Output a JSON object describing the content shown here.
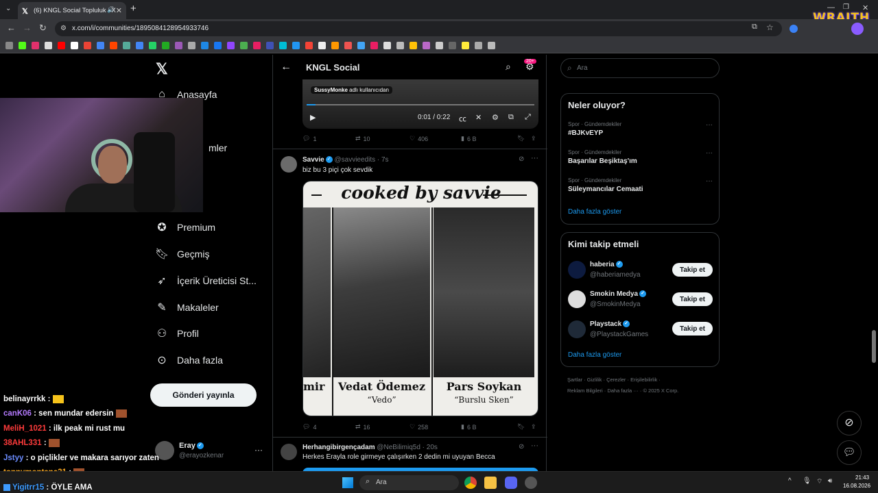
{
  "browser": {
    "tab_title": "(6) KNGL Social Topluluk / X",
    "url": "x.com/i/communities/1895084128954933746",
    "plus": "+"
  },
  "overlay": {
    "wraith_logo": "WRAITH"
  },
  "sidebar": {
    "items": [
      {
        "label": "Anasayfa",
        "icon": "home-icon"
      },
      {
        "label": "Premium",
        "icon": "premium-icon"
      },
      {
        "label": "Geçmiş",
        "icon": "bookmark-icon"
      },
      {
        "label": "İçerik Üreticisi St...",
        "icon": "rocket-icon"
      },
      {
        "label": "Makaleler",
        "icon": "article-icon"
      },
      {
        "label": "Profil",
        "icon": "profile-icon"
      },
      {
        "label": "Daha fazla",
        "icon": "more-circle-icon"
      }
    ],
    "post_button": "Gönderi yayınla",
    "partial_labels": [
      "mler",
      "t"
    ],
    "account": {
      "name": "Eray",
      "handle": "@erayozkenar",
      "more": "···"
    }
  },
  "header": {
    "title": "KNGL Social",
    "badge": "20+"
  },
  "video_post": {
    "overlay_user": "SussyMonke",
    "overlay_text": "adlı kullanıcıdan",
    "time": "0:01 / 0:22",
    "replies": "1",
    "reposts": "10",
    "likes": "406",
    "views": "6 B"
  },
  "post2": {
    "name": "Savvie",
    "handle": "@savvieedits · 7s",
    "text": "biz bu 3 piçi çok sevdik",
    "image_title": "cooked by savvie",
    "panels": [
      {
        "name": "mir",
        "nick": ""
      },
      {
        "name": "Vedat Ödemez",
        "nick": "“Vedo”"
      },
      {
        "name": "Pars Soykan",
        "nick": "“Burslu Sken”"
      }
    ],
    "replies": "4",
    "reposts": "16",
    "likes": "258",
    "views": "6 B"
  },
  "post3": {
    "name": "Herhangibirgençadam",
    "handle": "@NeBilimiq5d · 20s",
    "text": "Herkes Erayla role girmeye çalışırken 2 dedin mi uyuyan Becca"
  },
  "search": {
    "placeholder": "Ara"
  },
  "trends": {
    "title": "Neler oluyor?",
    "items": [
      {
        "category": "Spor · Gündemdekiler",
        "name": "#BJKvEYP"
      },
      {
        "category": "Spor · Gündemdekiler",
        "name": "Başarılar Beşiktaş'ım"
      },
      {
        "category": "Spor · Gündemdekiler",
        "name": "Süleymancılar Cemaati"
      }
    ],
    "show_more": "Daha fazla göster"
  },
  "who_to_follow": {
    "title": "Kimi takip etmeli",
    "items": [
      {
        "name": "haberia",
        "handle": "@haberiamedya",
        "button": "Takip et"
      },
      {
        "name": "Smokin Medya",
        "handle": "@SmokinMedya",
        "button": "Takip et"
      },
      {
        "name": "Playstack",
        "handle": "@PlaystackGames",
        "button": "Takip et"
      }
    ],
    "show_more": "Daha fazla göster"
  },
  "footer": {
    "line1": "Şartlar · Gizlilik · Çerezler · Erişilebilirlik ·",
    "line2": "Reklam Bilgileri · Daha fazla ··· · © 2025 X Corp."
  },
  "chat": [
    {
      "user": "belinayrrkk",
      "msg": "",
      "color": "#ffffff"
    },
    {
      "user": "canK06",
      "msg": "sen mundar edersin",
      "color": "#b57bff"
    },
    {
      "user": "MeliH_1021",
      "msg": "ilk peak mi rust mu",
      "color": "#ff3b3b"
    },
    {
      "user": "38AHL331",
      "msg": "",
      "color": "#ff3b3b"
    },
    {
      "user": "Jstyy",
      "msg": "o piçlikler ve makara sarıyor zaten",
      "color": "#6b8cff"
    },
    {
      "user": "tonnymontana31",
      "msg": "",
      "color": "#f5a623"
    },
    {
      "user": "Yigitrr15",
      "msg": "ÖYLE AMA",
      "color": "#3d9bff"
    }
  ],
  "taskbar": {
    "search": "Ara",
    "time": "21:43",
    "date": "16.08.2026"
  },
  "colors": {
    "accent": "#1d9bf0",
    "pink": "#f91880",
    "bg": "#000000",
    "border": "#2f3336"
  }
}
